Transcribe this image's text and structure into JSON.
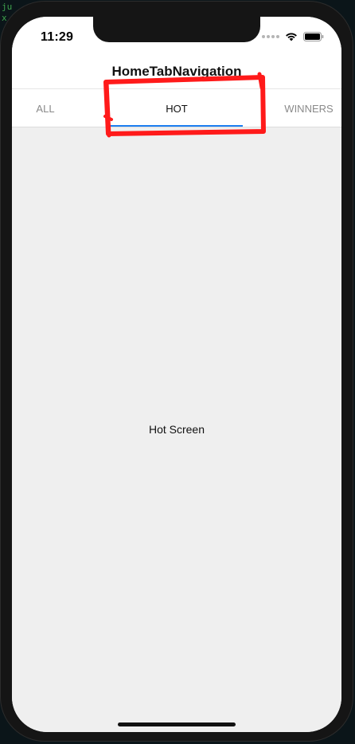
{
  "terminal": {
    "lines": "ju\nx"
  },
  "status_bar": {
    "time": "11:29",
    "icons": [
      "signal-dots-icon",
      "wifi-icon",
      "battery-icon"
    ]
  },
  "header": {
    "title": "HomeTabNavigation"
  },
  "tabs": [
    {
      "label": "ALL",
      "active": false
    },
    {
      "label": "HOT",
      "active": true
    },
    {
      "label": "WINNERS",
      "active": false
    }
  ],
  "content": {
    "text": "Hot Screen"
  },
  "colors": {
    "active_indicator": "#1d7ef0",
    "annotation": "#ff1a1a",
    "content_bg": "#efefef"
  }
}
